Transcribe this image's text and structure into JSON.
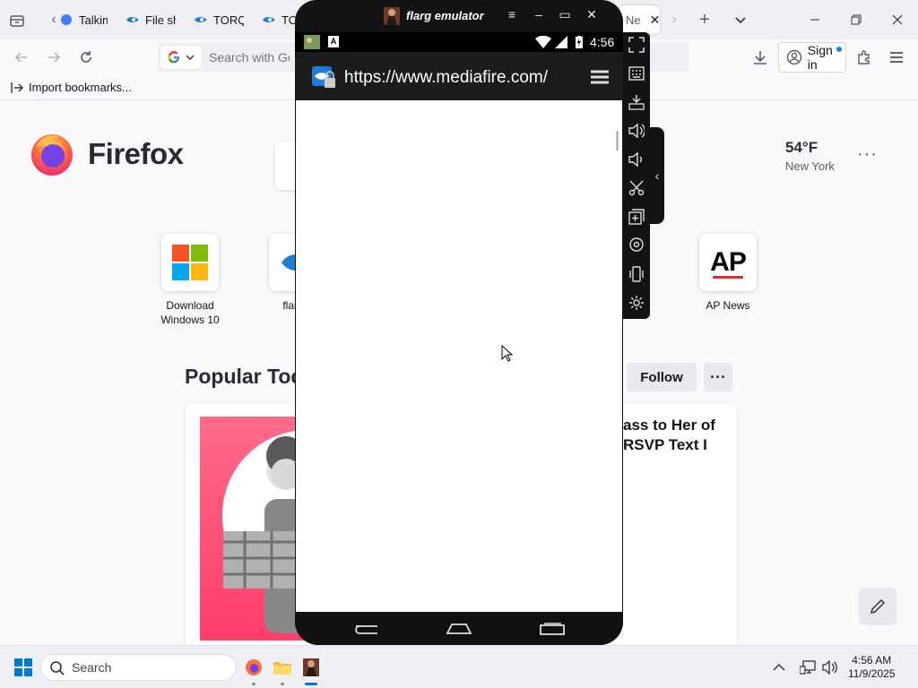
{
  "browser": {
    "tabs": [
      {
        "label": "Talkin"
      },
      {
        "label": "File sh"
      },
      {
        "label": "TORQ"
      },
      {
        "label": "TOR"
      },
      {
        "label": "Ne"
      }
    ],
    "url_placeholder": "Search with Goo",
    "sign_in_label": "Sign in",
    "import_bookmarks_label": "Import bookmarks..."
  },
  "newtab": {
    "brand": "Firefox",
    "weather": {
      "temp": "54°F",
      "city": "New York"
    },
    "shortcuts": [
      {
        "label": "Download Windows 10"
      },
      {
        "label": "flarg e"
      },
      {
        "label": "AP News",
        "tile_text": "AP"
      }
    ],
    "popular_title": "Popular Toc",
    "follow_label": "Follow",
    "more_label": "···",
    "story_headline": "ass to Her of RSVP Text I"
  },
  "emulator": {
    "title": "flarg emulator",
    "status_time": "4:56",
    "url": "https://www.mediafire.com/"
  },
  "taskbar": {
    "search_label": "Search",
    "time": "4:56 AM",
    "date": "11/9/2025"
  },
  "colors": {
    "firefox_orange": "#ff7139",
    "ap_red": "#e32b2b",
    "emulator_body": "#131313",
    "story_pink": "#ff3d6a"
  }
}
